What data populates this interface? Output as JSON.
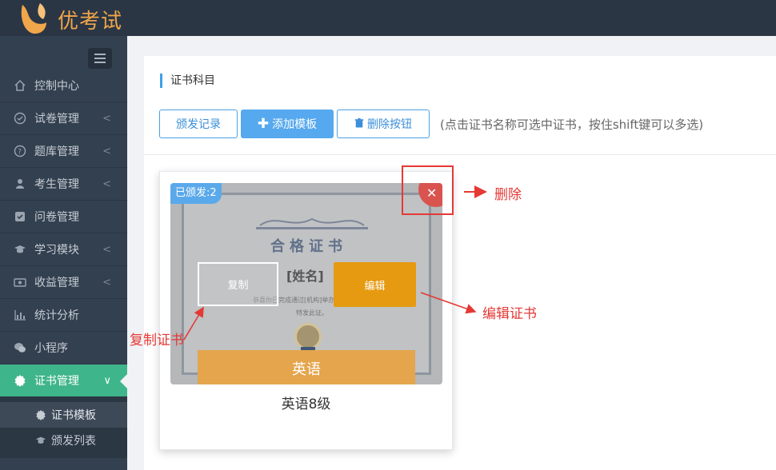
{
  "app": {
    "brand": "优考试",
    "brand_color": "#f0a64a"
  },
  "sidebar": {
    "items": [
      {
        "label": "控制中心",
        "icon": "home-icon",
        "has_arrow": false
      },
      {
        "label": "试卷管理",
        "icon": "check-circle-icon",
        "has_arrow": true
      },
      {
        "label": "题库管理",
        "icon": "question-circle-icon",
        "has_arrow": true
      },
      {
        "label": "考生管理",
        "icon": "user-icon",
        "has_arrow": true
      },
      {
        "label": "问卷管理",
        "icon": "checkbox-icon",
        "has_arrow": false
      },
      {
        "label": "学习模块",
        "icon": "graduation-cap-icon",
        "has_arrow": true
      },
      {
        "label": "收益管理",
        "icon": "money-icon",
        "has_arrow": true
      },
      {
        "label": "统计分析",
        "icon": "bar-chart-icon",
        "has_arrow": false
      },
      {
        "label": "小程序",
        "icon": "wechat-icon",
        "has_arrow": false
      },
      {
        "label": "证书管理",
        "icon": "certificate-icon",
        "has_arrow": true,
        "active": true
      }
    ],
    "subitems": [
      {
        "label": "证书模板",
        "icon": "certificate-icon",
        "active": true
      },
      {
        "label": "颁发列表",
        "icon": "graduation-cap-icon",
        "active": false
      }
    ],
    "active_color": "#3fb58b"
  },
  "main": {
    "section_title": "证书科目",
    "toolbar": {
      "issue_record_label": "颁发记录",
      "add_template_label": "添加模板",
      "delete_label": "删除按钮",
      "hint": "(点击证书名称可选中证书，按住shift键可以多选)"
    },
    "card": {
      "issued_badge": "已颁发:2",
      "cert_heading": "合格证书",
      "cert_name_placeholder": "[姓名]",
      "cert_text_line1": "恭喜你已完成通过[机构]举办的\"X",
      "cert_text_line2": "特发此证。",
      "copy_label": "复制",
      "edit_label": "编辑",
      "subject_label": "英语",
      "title": "英语8级",
      "close_symbol": "✕",
      "delete_color": "#d9534f",
      "edit_color": "#e59a11",
      "subject_color": "#e4a54d"
    }
  },
  "annotations": {
    "delete": "删除",
    "edit_cert": "编辑证书",
    "copy_cert": "复制证书",
    "color": "#e53935"
  }
}
